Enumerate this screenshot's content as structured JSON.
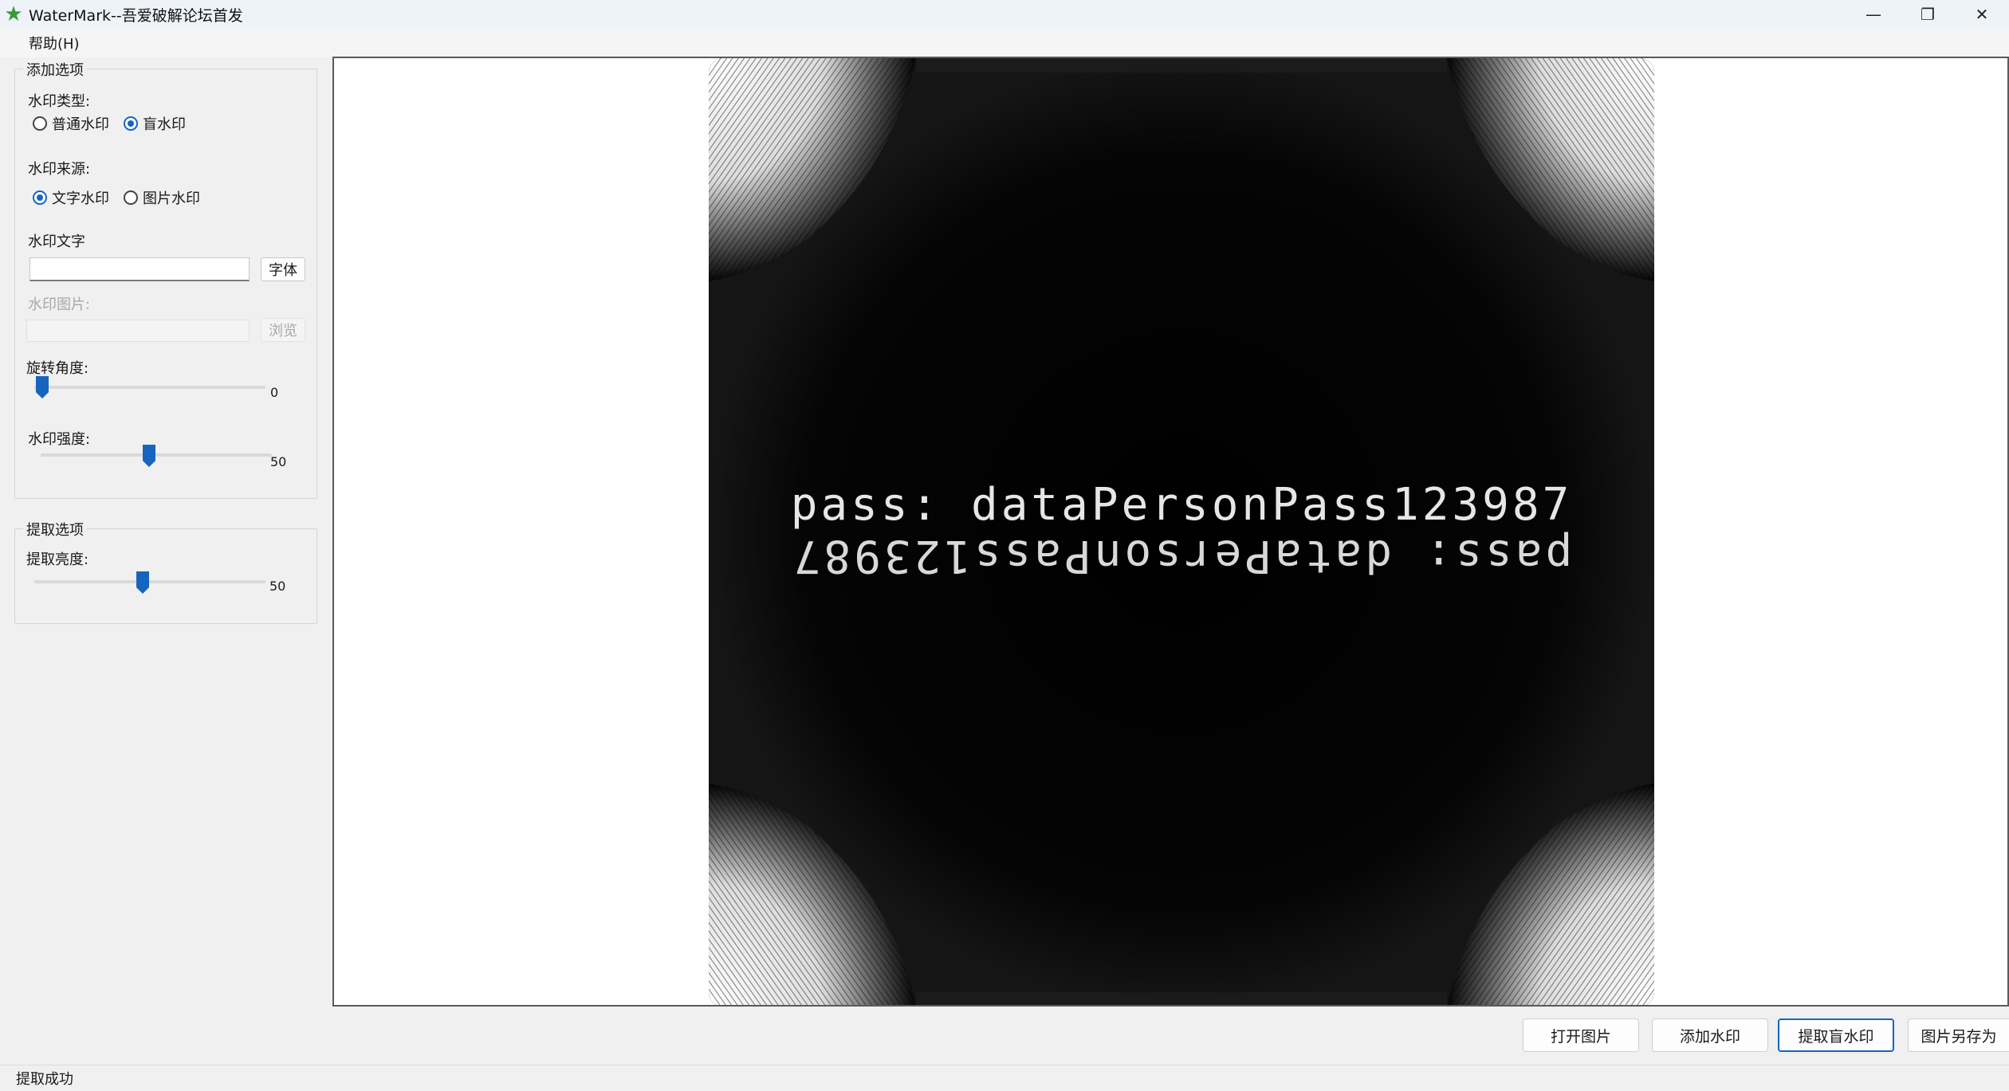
{
  "window": {
    "title": "WaterMark--吾爱破解论坛首发",
    "icon": "star-icon",
    "controls": [
      "minimize-icon",
      "restore-icon",
      "close-icon"
    ]
  },
  "menu": {
    "items": [
      {
        "label": "帮助(H)",
        "shortcut": "H"
      }
    ]
  },
  "add_options": {
    "title": "添加选项",
    "type_label": "水印类型:",
    "type_options": [
      {
        "label": "普通水印",
        "checked": false
      },
      {
        "label": "盲水印",
        "checked": true
      }
    ],
    "source_label": "水印来源:",
    "source_options": [
      {
        "label": "文字水印",
        "checked": true
      },
      {
        "label": "图片水印",
        "checked": false
      }
    ],
    "text_label": "水印文字",
    "text_value": "",
    "font_button": "字体",
    "image_label": "水印图片:",
    "image_value": "",
    "browse_button": "浏览",
    "rotation_label": "旋转角度:",
    "rotation_value": "0",
    "rotation_fraction": 0.0,
    "strength_label": "水印强度:",
    "strength_value": "50",
    "strength_fraction": 0.5
  },
  "extract_options": {
    "title": "提取选项",
    "brightness_label": "提取亮度:",
    "brightness_value": "50",
    "brightness_fraction": 0.5
  },
  "image": {
    "line1": "pass: dataPersonPass123987",
    "line2": "pass: dataPersonPass123987"
  },
  "actions": {
    "open": "打开图片",
    "add": "添加水印",
    "extract": "提取盲水印",
    "save_as": "图片另存为"
  },
  "status": {
    "text": "提取成功"
  },
  "colors": {
    "accent": "#1565c0",
    "background": "#f0f0f0",
    "image_bg": "#050505"
  }
}
